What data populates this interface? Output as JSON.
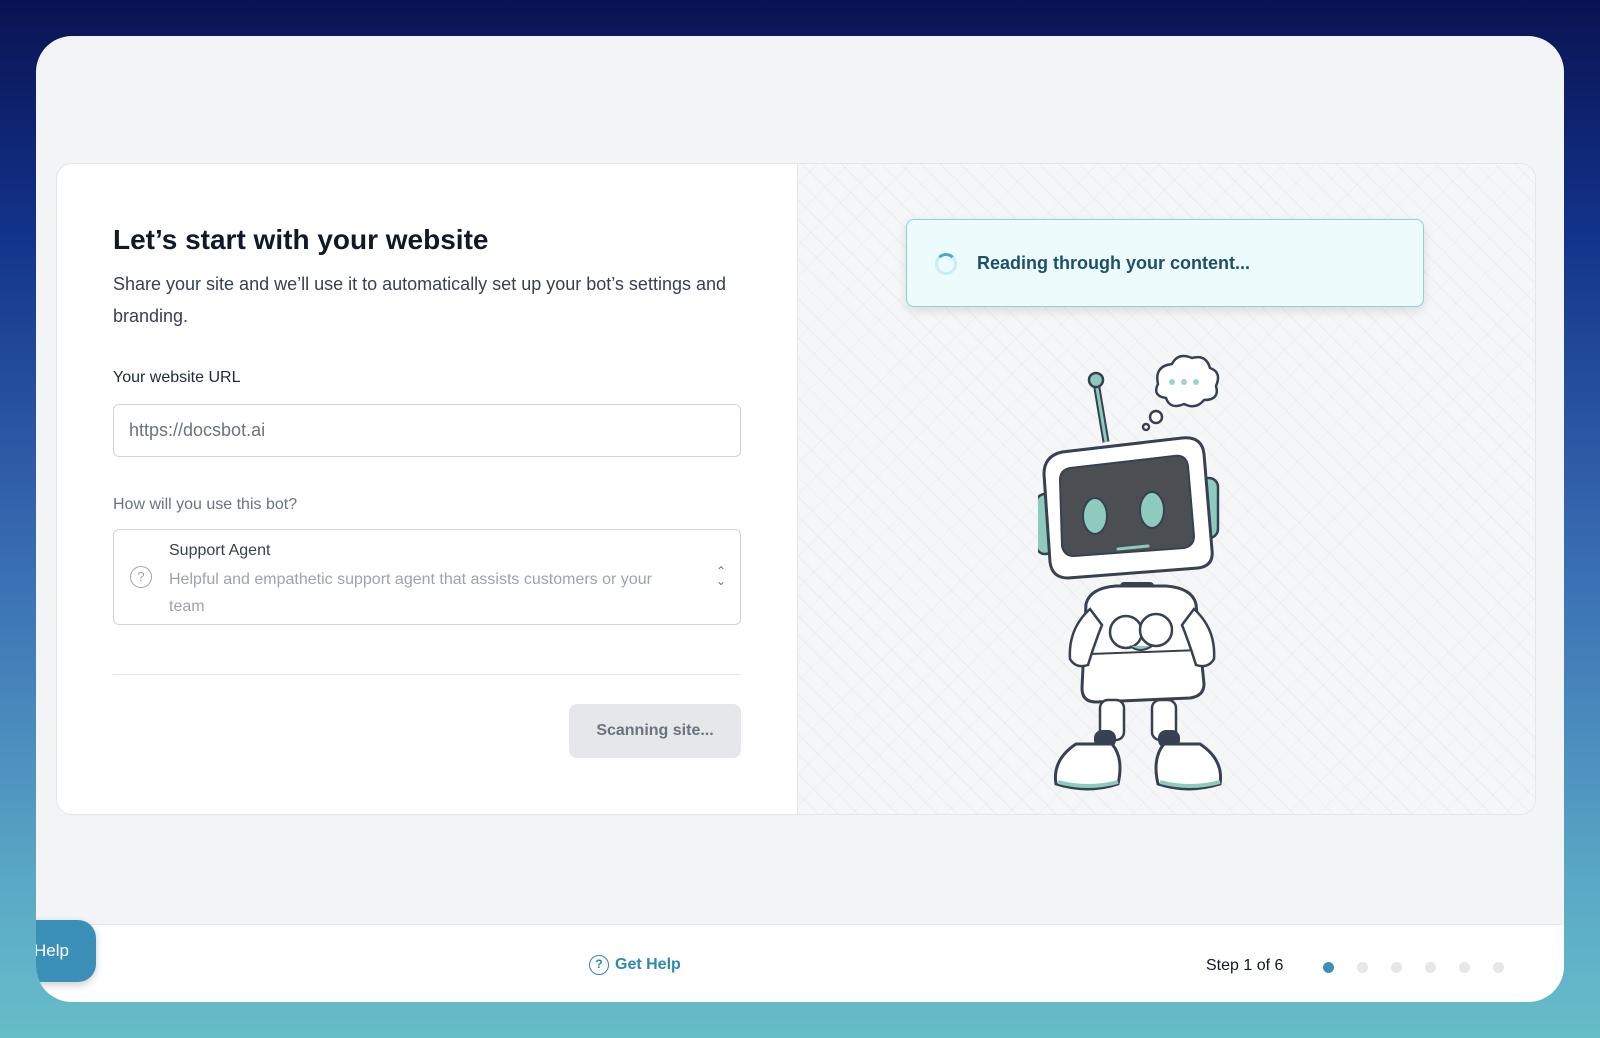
{
  "form": {
    "title": "Let’s start with your website",
    "subtitle": "Share your site and we’ll use it to automatically set up your bot’s settings and branding.",
    "url_label": "Your website URL",
    "url_placeholder": "https://docsbot.ai",
    "use_label": "How will you use this bot?",
    "use_selected_title": "Support Agent",
    "use_selected_description": "Helpful and empathetic support agent that assists customers or your team",
    "scan_button_label": "Scanning site..."
  },
  "status": {
    "text": "Reading through your content..."
  },
  "footer": {
    "help_tab_label": "Help",
    "get_help_label": "Get Help",
    "step_text": "Step 1 of 6",
    "total_steps": 6,
    "current_step": 1
  },
  "colors": {
    "accent": "#3b90b8",
    "robot_teal": "#8ccbbd",
    "status_bg": "#ecfcfd"
  },
  "icons": {
    "select_option": "question-circle-icon",
    "select_toggle": "chevron-up-down-icon",
    "status": "spinner-icon",
    "get_help": "question-circle-icon"
  }
}
